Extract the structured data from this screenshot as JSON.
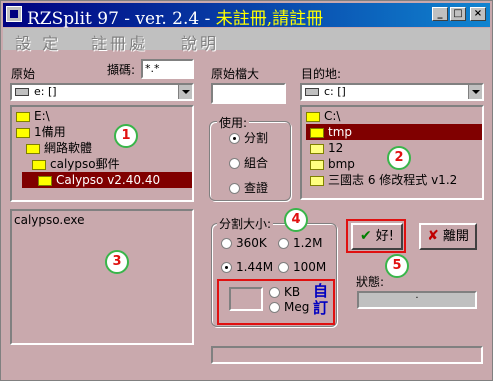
{
  "title": {
    "main": "RZSplit 97 - ver. 2.4 - ",
    "unreg": "未註冊,請註冊"
  },
  "menu": [
    "設 定",
    "註冊處",
    "說明"
  ],
  "source": {
    "label": "原始",
    "mask_label": "擷碼:",
    "mask_value": "*.*",
    "drive": "e: []",
    "folders": [
      "E:\\",
      "1備用",
      "網路軟體",
      "calypso郵件",
      "Calypso v2.40.40"
    ],
    "files": [
      "calypso.exe"
    ]
  },
  "size_label": "原始檔大",
  "dest": {
    "label": "目的地:",
    "drive": "c: []",
    "folders": [
      "C:\\",
      "tmp",
      "12",
      "bmp",
      "三國志 6 修改程式 v1.2"
    ]
  },
  "use": {
    "title": "使用:",
    "options": [
      "分割",
      "組合",
      "查證"
    ]
  },
  "split_size": {
    "title": "分割大小:",
    "options": [
      "360K",
      "1.2M",
      "1.44M",
      "100M"
    ],
    "units": [
      "KB",
      "Meg"
    ],
    "custom_label": "自訂"
  },
  "ok_label": "好!",
  "exit_label": "離開",
  "status_label": "狀態:",
  "status_value": "·",
  "markers": [
    "1",
    "2",
    "3",
    "4",
    "5"
  ],
  "colors": {
    "accent_red": "#e01010",
    "marker_green": "#39b54a",
    "selection": "#800000",
    "panel": "#c9a9ad"
  }
}
